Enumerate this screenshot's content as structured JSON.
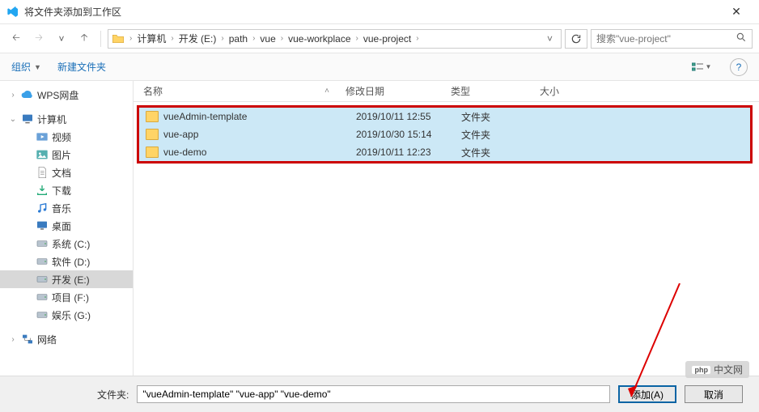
{
  "titlebar": {
    "title": "将文件夹添加到工作区"
  },
  "nav": {
    "breadcrumb": [
      "计算机",
      "开发 (E:)",
      "path",
      "vue",
      "vue-workplace",
      "vue-project"
    ],
    "search_placeholder": "搜索\"vue-project\""
  },
  "toolbar": {
    "organize": "组织",
    "new_folder": "新建文件夹"
  },
  "sidebar": {
    "wps": "WPS网盘",
    "computer": "计算机",
    "items": [
      {
        "label": "视频",
        "icon": "video"
      },
      {
        "label": "图片",
        "icon": "picture"
      },
      {
        "label": "文档",
        "icon": "document"
      },
      {
        "label": "下载",
        "icon": "download"
      },
      {
        "label": "音乐",
        "icon": "music"
      },
      {
        "label": "桌面",
        "icon": "desktop"
      },
      {
        "label": "系统 (C:)",
        "icon": "drive"
      },
      {
        "label": "软件 (D:)",
        "icon": "drive"
      },
      {
        "label": "开发 (E:)",
        "icon": "drive",
        "selected": true
      },
      {
        "label": "项目 (F:)",
        "icon": "drive"
      },
      {
        "label": "娱乐 (G:)",
        "icon": "drive"
      }
    ],
    "network": "网络"
  },
  "columns": {
    "name": "名称",
    "date": "修改日期",
    "type": "类型",
    "size": "大小"
  },
  "files": [
    {
      "name": "vueAdmin-template",
      "date": "2019/10/11 12:55",
      "type": "文件夹"
    },
    {
      "name": "vue-app",
      "date": "2019/10/30 15:14",
      "type": "文件夹"
    },
    {
      "name": "vue-demo",
      "date": "2019/10/11 12:23",
      "type": "文件夹"
    }
  ],
  "footer": {
    "label": "文件夹:",
    "value": "\"vueAdmin-template\" \"vue-app\" \"vue-demo\"",
    "add": "添加(A)",
    "cancel": "取消"
  },
  "watermark": "中文网"
}
